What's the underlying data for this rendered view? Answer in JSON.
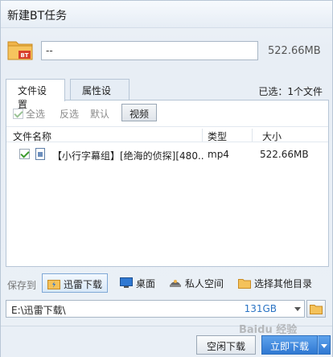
{
  "window": {
    "title": "新建BT任务"
  },
  "file": {
    "icon_badge": "BT",
    "name_value": "--",
    "total_size": "522.66MB"
  },
  "tabs": [
    {
      "label": "文件设置",
      "active": true
    },
    {
      "label": "属性设置",
      "active": false
    }
  ],
  "selected_count": "已选：1个文件",
  "filters": {
    "select_all": "全选",
    "invert": "反选",
    "default": "默认",
    "video": "视频"
  },
  "table": {
    "headers": {
      "name": "文件名称",
      "type": "类型",
      "size": "大小"
    },
    "rows": [
      {
        "checked": true,
        "name": "【小行字幕组】[绝海的侦探][480...",
        "type": "mp4",
        "size": "522.66MB"
      }
    ]
  },
  "save": {
    "label": "保存到",
    "locations": {
      "thunder": "迅雷下载",
      "desktop": "桌面",
      "private": "私人空间",
      "other": "选择其他目录"
    },
    "path_value": "E:\\迅雷下载\\",
    "free_space": "131GB"
  },
  "footer": {
    "close_download": "空闲下载",
    "start_download": "立即下载"
  },
  "watermark": "Baidu 经验",
  "colors": {
    "accent": "#2f78d2",
    "free_space": "#2b74c4",
    "check": "#3c9a2e"
  }
}
